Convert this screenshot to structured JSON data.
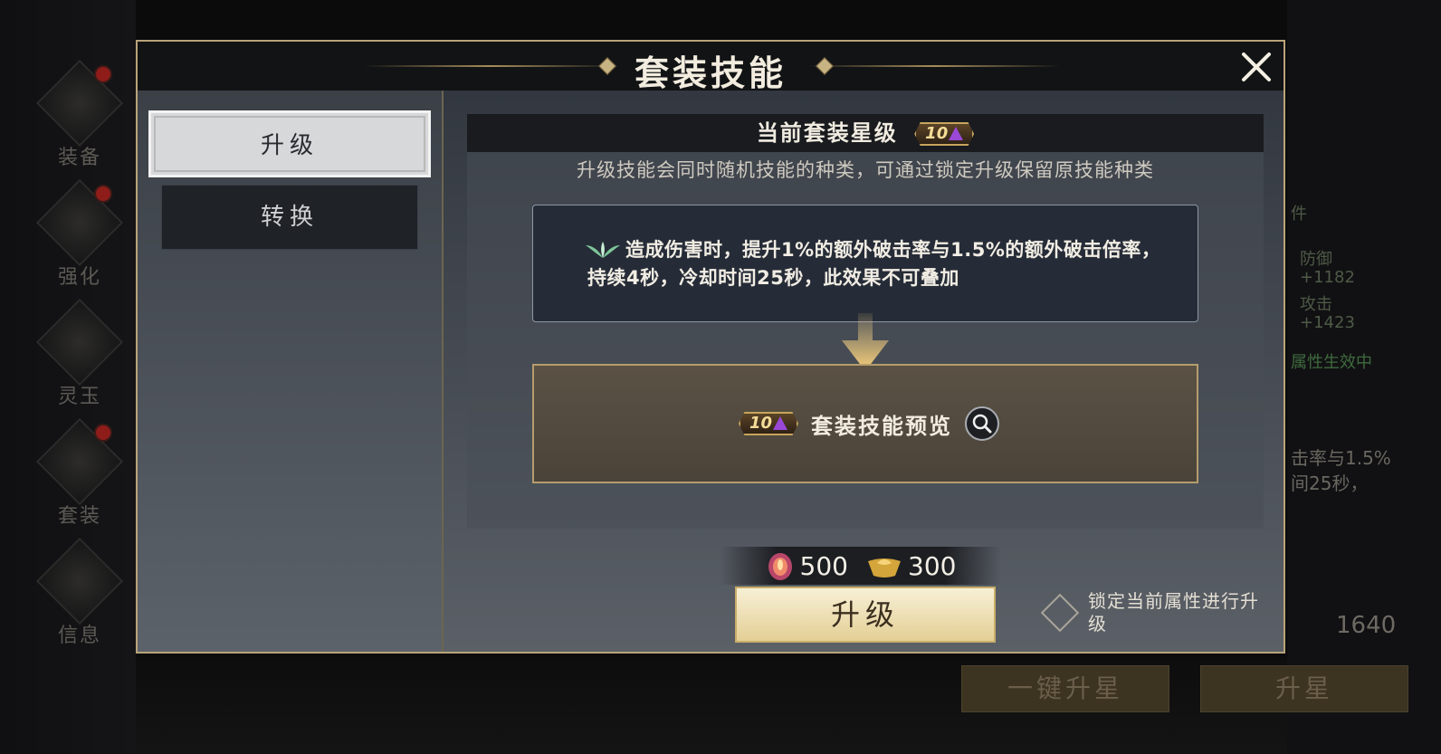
{
  "sidebar": {
    "items": [
      {
        "label": "装备",
        "badge": true
      },
      {
        "label": "强化",
        "badge": true
      },
      {
        "label": "灵玉",
        "badge": false
      },
      {
        "label": "套装",
        "badge": true
      },
      {
        "label": "信息",
        "badge": false
      }
    ]
  },
  "background_right": {
    "count_label": "件",
    "stat1_label": "防御",
    "stat1_value": "+1182",
    "stat2_label": "攻击",
    "stat2_value": "+1423",
    "active_text": "属性生效中",
    "skill_text_line1": "击率与1.5%",
    "skill_text_line2": "间25秒，",
    "currency_value": "1640",
    "one_click_star_label": "一键升星",
    "star_up_label": "升星"
  },
  "modal": {
    "title": "套装技能",
    "tabs": [
      {
        "label": "升级",
        "active": true
      },
      {
        "label": "转换",
        "active": false
      }
    ],
    "star_header_label": "当前套装星级",
    "star_level": "10",
    "description": "升级技能会同时随机技能的种类，可通过锁定升级保留原技能种类",
    "skill_effect": "造成伤害时，提升1%的额外破击率与1.5%的额外破击倍率，持续4秒，冷却时间25秒，此效果不可叠加",
    "preview_star_level": "10",
    "preview_label": "套装技能预览",
    "cost": [
      {
        "icon": "crystal-orb-icon",
        "amount": "500"
      },
      {
        "icon": "gold-ingot-icon",
        "amount": "300"
      }
    ],
    "upgrade_button": "升级",
    "lock_label": "锁定当前属性进行升级"
  },
  "colors": {
    "gold_border": "#b9a37a",
    "badge_purple": "#9a48d6",
    "button_gold": "#e4cf95"
  }
}
